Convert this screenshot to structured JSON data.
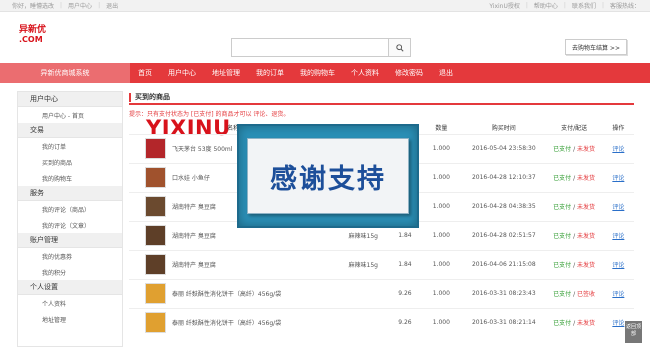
{
  "topbar": {
    "greeting": "你好，睡懵选改",
    "user_center": "用户中心",
    "logout": "退出",
    "site_notice": "YixinU授权",
    "help_center": "帮助中心",
    "contact": "联系我们",
    "hotline": "客服热线："
  },
  "logo": {
    "main": "YIXINU",
    "side_top": "异新优",
    "side_bottom": ".COM"
  },
  "search": {
    "placeholder": ""
  },
  "cart_button": "去购物车结算 >>",
  "nav": {
    "category": "异新优商城系统",
    "items": [
      "首页",
      "用户中心",
      "地址管理",
      "我的订单",
      "我的购物车",
      "个人资料",
      "修改密码",
      "退出"
    ]
  },
  "sidebar": {
    "sections": [
      {
        "title": "用户中心",
        "items": [
          "用户中心 - 首页"
        ]
      },
      {
        "title": "交易",
        "items": [
          "我的订单",
          "买到的商品",
          "我的购物车"
        ]
      },
      {
        "title": "服务",
        "items": [
          "我的评论（商品）",
          "我的评论（文章）"
        ]
      },
      {
        "title": "账户管理",
        "items": [
          "我的优惠券",
          "我的积分"
        ]
      },
      {
        "title": "个人设置",
        "items": [
          "个人资料",
          "地址管理"
        ]
      }
    ]
  },
  "main": {
    "title": "买到的商品",
    "hint": "提示：只有支付状态为 [已支付] 的商品才可以 评论、退货。",
    "columns": [
      "名称",
      "",
      "价格",
      "数量",
      "购买时间",
      "支付/配送",
      "操作"
    ],
    "rows": [
      {
        "name": "飞天茅台 53度 500ml",
        "spec": "",
        "price": "",
        "qty": "1.000",
        "time": "2016-05-04 23:58:30",
        "paid": "已支付",
        "ship": "未发货",
        "op": "评论",
        "thumb": "#b3262a"
      },
      {
        "name": "口水娃 小鱼仔",
        "spec": "",
        "price": "",
        "qty": "1.000",
        "time": "2016-04-28 12:10:37",
        "paid": "已支付",
        "ship": "未发货",
        "op": "评论",
        "thumb": "#a0522d"
      },
      {
        "name": "湖南特产 臭豆腐",
        "spec": "",
        "price": "",
        "qty": "1.000",
        "time": "2016-04-28 04:38:35",
        "paid": "已支付",
        "ship": "未发货",
        "op": "评论",
        "thumb": "#6b4a2f"
      },
      {
        "name": "湖南特产 臭豆腐",
        "spec": "麻辣味15g",
        "price": "1.84",
        "qty": "1.000",
        "time": "2016-04-28 02:51:57",
        "paid": "已支付",
        "ship": "未发货",
        "op": "评论",
        "thumb": "#5e3f28"
      },
      {
        "name": "湖南特产 臭豆腐",
        "spec": "麻辣味15g",
        "price": "1.84",
        "qty": "1.000",
        "time": "2016-04-06 21:15:08",
        "paid": "已支付",
        "ship": "未发货",
        "op": "评论",
        "thumb": "#5e3f28"
      },
      {
        "name": "泰丽 纤麸酥性消化饼干（高纤）456g/袋",
        "spec": "",
        "price": "9.26",
        "qty": "1.000",
        "time": "2016-03-31 08:23:43",
        "paid": "已支付",
        "ship": "已签收",
        "op": "评论",
        "thumb": "#e0a030"
      },
      {
        "name": "泰丽 纤麸酥性消化饼干（高纤）456g/袋",
        "spec": "",
        "price": "9.26",
        "qty": "1.000",
        "time": "2016-03-31 08:21:14",
        "paid": "已支付",
        "ship": "未发货",
        "op": "评论",
        "thumb": "#e0a030"
      }
    ]
  },
  "overlay_text": "感谢支持",
  "back_to_top": "返回顶部"
}
